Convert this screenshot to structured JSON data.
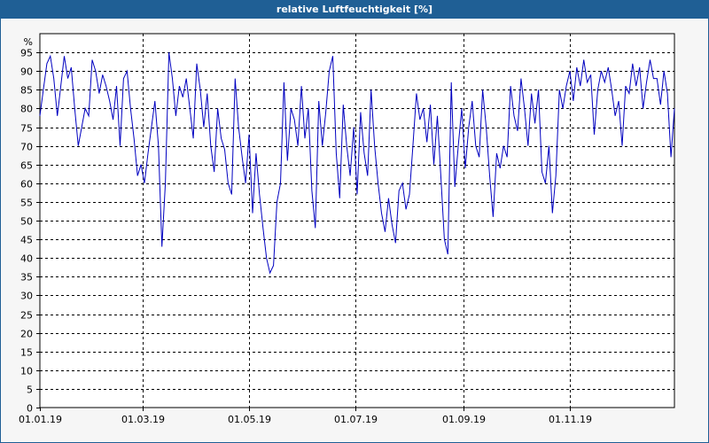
{
  "window": {
    "title": "relative Luftfeuchtigkeit [%]"
  },
  "chart_data": {
    "type": "line",
    "title": "relative Luftfeuchtigkeit [%]",
    "ylabel": "%",
    "xlabel": "",
    "ylim": [
      0,
      100
    ],
    "xlim": [
      "2019-01-01",
      "2019-12-31"
    ],
    "y_ticks": [
      0,
      5,
      10,
      15,
      20,
      25,
      30,
      35,
      40,
      45,
      50,
      55,
      60,
      65,
      70,
      75,
      80,
      85,
      90,
      95
    ],
    "x_ticks": [
      {
        "date": "2019-01-01",
        "label": "01.01.19"
      },
      {
        "date": "2019-03-01",
        "label": "01.03.19"
      },
      {
        "date": "2019-05-01",
        "label": "01.05.19"
      },
      {
        "date": "2019-07-01",
        "label": "01.07.19"
      },
      {
        "date": "2019-09-01",
        "label": "01.09.19"
      },
      {
        "date": "2019-11-01",
        "label": "01.11.19"
      }
    ],
    "grid": true,
    "line_color": "#0000c0",
    "series": [
      {
        "x": [
          "2019-01-01",
          "2019-01-03",
          "2019-01-05",
          "2019-01-07",
          "2019-01-09",
          "2019-01-11",
          "2019-01-13",
          "2019-01-15",
          "2019-01-17",
          "2019-01-19",
          "2019-01-21",
          "2019-01-23",
          "2019-01-25",
          "2019-01-27",
          "2019-01-29",
          "2019-01-31",
          "2019-02-02",
          "2019-02-04",
          "2019-02-06",
          "2019-02-08",
          "2019-02-10",
          "2019-02-12",
          "2019-02-14",
          "2019-02-16",
          "2019-02-18",
          "2019-02-20",
          "2019-02-22",
          "2019-02-24",
          "2019-02-26",
          "2019-02-28",
          "2019-03-02",
          "2019-03-04",
          "2019-03-06",
          "2019-03-08",
          "2019-03-10",
          "2019-03-12",
          "2019-03-14",
          "2019-03-16",
          "2019-03-18",
          "2019-03-20",
          "2019-03-22",
          "2019-03-24",
          "2019-03-26",
          "2019-03-28",
          "2019-03-30",
          "2019-04-01",
          "2019-04-03",
          "2019-04-05",
          "2019-04-07",
          "2019-04-09",
          "2019-04-11",
          "2019-04-13",
          "2019-04-15",
          "2019-04-17",
          "2019-04-19",
          "2019-04-21",
          "2019-04-23",
          "2019-04-25",
          "2019-04-27",
          "2019-04-29",
          "2019-05-01",
          "2019-05-03",
          "2019-05-05",
          "2019-05-07",
          "2019-05-09",
          "2019-05-11",
          "2019-05-13",
          "2019-05-15",
          "2019-05-17",
          "2019-05-19",
          "2019-05-21",
          "2019-05-23",
          "2019-05-25",
          "2019-05-27",
          "2019-05-29",
          "2019-05-31",
          "2019-06-02",
          "2019-06-04",
          "2019-06-06",
          "2019-06-08",
          "2019-06-10",
          "2019-06-12",
          "2019-06-14",
          "2019-06-16",
          "2019-06-18",
          "2019-06-20",
          "2019-06-22",
          "2019-06-24",
          "2019-06-26",
          "2019-06-28",
          "2019-06-30",
          "2019-07-02",
          "2019-07-04",
          "2019-07-06",
          "2019-07-08",
          "2019-07-10",
          "2019-07-12",
          "2019-07-14",
          "2019-07-16",
          "2019-07-18",
          "2019-07-20",
          "2019-07-22",
          "2019-07-24",
          "2019-07-26",
          "2019-07-28",
          "2019-07-30",
          "2019-08-01",
          "2019-08-03",
          "2019-08-05",
          "2019-08-07",
          "2019-08-09",
          "2019-08-11",
          "2019-08-13",
          "2019-08-15",
          "2019-08-17",
          "2019-08-19",
          "2019-08-21",
          "2019-08-23",
          "2019-08-25",
          "2019-08-27",
          "2019-08-29",
          "2019-08-31",
          "2019-09-02",
          "2019-09-04",
          "2019-09-06",
          "2019-09-08",
          "2019-09-10",
          "2019-09-12",
          "2019-09-14",
          "2019-09-16",
          "2019-09-18",
          "2019-09-20",
          "2019-09-22",
          "2019-09-24",
          "2019-09-26",
          "2019-09-28",
          "2019-09-30",
          "2019-10-02",
          "2019-10-04",
          "2019-10-06",
          "2019-10-08",
          "2019-10-10",
          "2019-10-12",
          "2019-10-14",
          "2019-10-16",
          "2019-10-18",
          "2019-10-20",
          "2019-10-22",
          "2019-10-24",
          "2019-10-26",
          "2019-10-28",
          "2019-10-30",
          "2019-11-01",
          "2019-11-03",
          "2019-11-05",
          "2019-11-07",
          "2019-11-09",
          "2019-11-11",
          "2019-11-13",
          "2019-11-15",
          "2019-11-17",
          "2019-11-19",
          "2019-11-21",
          "2019-11-23",
          "2019-11-25",
          "2019-11-27",
          "2019-11-29",
          "2019-12-01",
          "2019-12-03",
          "2019-12-05",
          "2019-12-07",
          "2019-12-09",
          "2019-12-11",
          "2019-12-13",
          "2019-12-15",
          "2019-12-17",
          "2019-12-19",
          "2019-12-21",
          "2019-12-23",
          "2019-12-25",
          "2019-12-27",
          "2019-12-29",
          "2019-12-31"
        ],
        "values": [
          78,
          85,
          92,
          94,
          88,
          78,
          86,
          94,
          88,
          91,
          80,
          70,
          75,
          80,
          78,
          93,
          90,
          84,
          89,
          86,
          82,
          77,
          86,
          70,
          88,
          90,
          80,
          72,
          62,
          65,
          60,
          68,
          75,
          82,
          70,
          43,
          60,
          95,
          88,
          78,
          86,
          83,
          88,
          80,
          72,
          92,
          85,
          75,
          84,
          70,
          63,
          80,
          72,
          69,
          60,
          57,
          88,
          75,
          67,
          60,
          73,
          52,
          68,
          57,
          48,
          40,
          36,
          38,
          55,
          60,
          87,
          66,
          80,
          77,
          70,
          86,
          72,
          80,
          58,
          48,
          82,
          70,
          79,
          90,
          94,
          68,
          56,
          81,
          70,
          62,
          75,
          57,
          79,
          68,
          62,
          85,
          70,
          60,
          52,
          47,
          56,
          49,
          44,
          58,
          60,
          53,
          57,
          70,
          84,
          77,
          80,
          71,
          81,
          65,
          78,
          62,
          45,
          41,
          87,
          59,
          70,
          80,
          64,
          75,
          82,
          70,
          67,
          85,
          75,
          62,
          51,
          68,
          64,
          70,
          67,
          86,
          78,
          74,
          88,
          80,
          70,
          84,
          76,
          85,
          63,
          60,
          70,
          52,
          62,
          85,
          80,
          86,
          90,
          82,
          91,
          86,
          93,
          87,
          89,
          73,
          85,
          90,
          87,
          91,
          85,
          78,
          82,
          70,
          86,
          84,
          92,
          86,
          91,
          80,
          87,
          93,
          88,
          88,
          81,
          90,
          84,
          67,
          80
        ]
      }
    ]
  }
}
